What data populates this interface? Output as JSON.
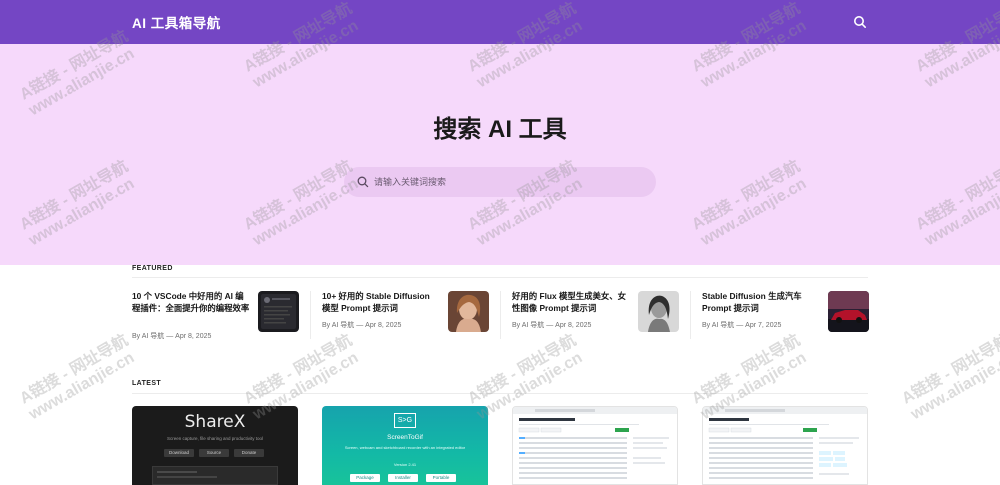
{
  "header": {
    "site_title": "AI 工具箱导航",
    "search_icon": "search-icon"
  },
  "hero": {
    "title": "搜索 AI 工具",
    "search": {
      "placeholder": "请输入关键词搜索",
      "value": "",
      "icon": "search-icon"
    }
  },
  "featured": {
    "label": "FEATURED",
    "items": [
      {
        "title": "10 个 VSCode 中好用的 AI 编程插件：全面提升你的编程效率",
        "meta": "By AI 导航 — Apr 8, 2025"
      },
      {
        "title": "10+ 好用的 Stable Diffusion 模型 Prompt 提示词",
        "meta": "By AI 导航 — Apr 8, 2025"
      },
      {
        "title": "好用的 Flux 模型生成美女、女性图像 Prompt 提示词",
        "meta": "By AI 导航 — Apr 8, 2025"
      },
      {
        "title": "Stable Diffusion 生成汽车 Prompt 提示词",
        "meta": "By AI 导航 — Apr 7, 2025"
      }
    ]
  },
  "latest": {
    "label": "LATEST",
    "cards": [
      {
        "brand": "ShareX",
        "tagline": "Screen capture, file sharing and productivity tool",
        "buttons": [
          "Download",
          "Source",
          "Donate"
        ]
      },
      {
        "logo": "S>G",
        "brand": "ScreenToGif",
        "tagline": "Screen, webcam and sketchboard recorder with an integrated editor",
        "version": "Version 2.41",
        "buttons": [
          "Package",
          "Installer",
          "Portable"
        ]
      },
      {
        "type": "github-repo-screenshot"
      },
      {
        "type": "github-repo-screenshot"
      }
    ]
  },
  "watermark": {
    "line1": "A链接 - 网址导航",
    "line2": "www.alianjie.cn"
  }
}
